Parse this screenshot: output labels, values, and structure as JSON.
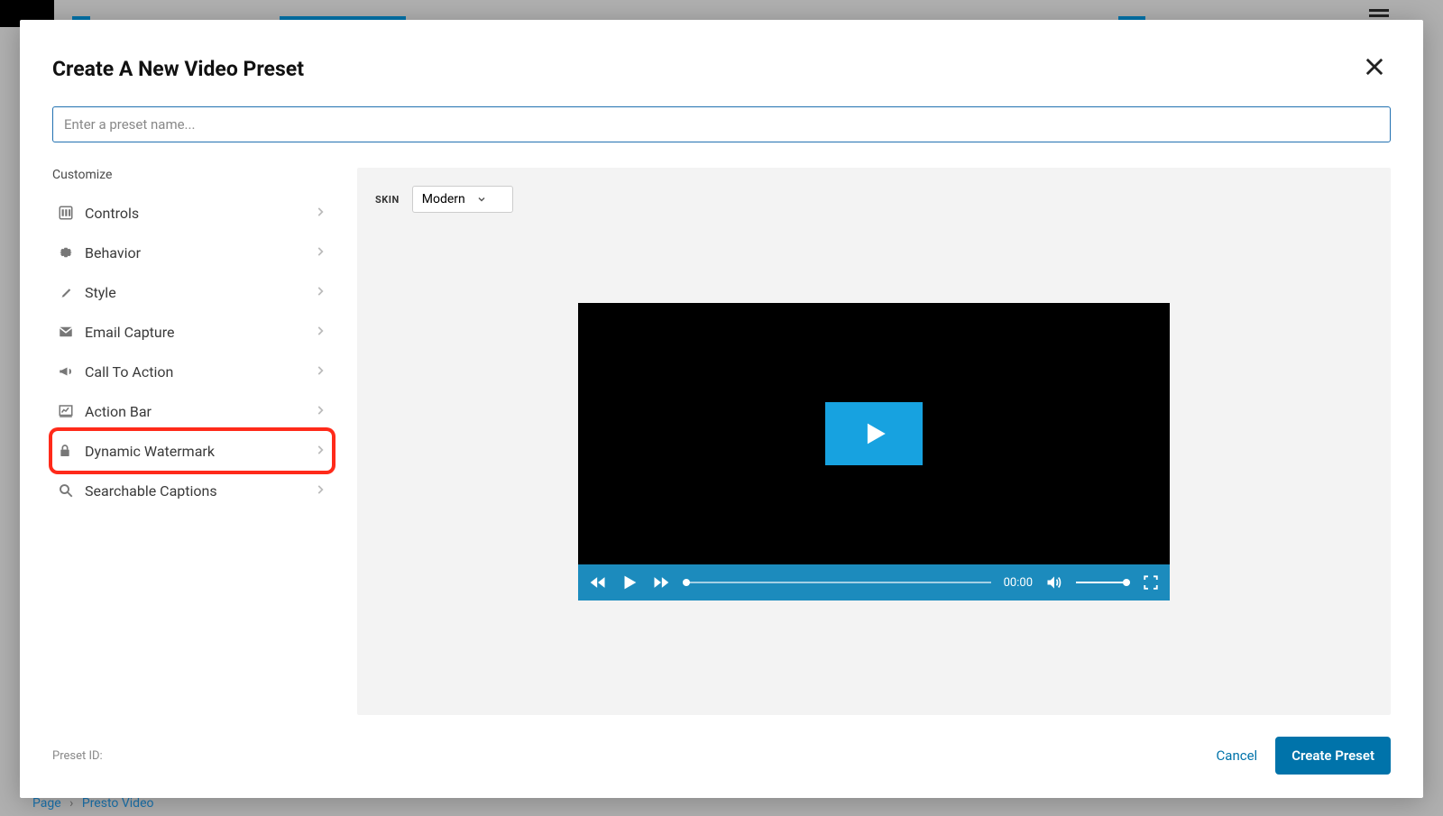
{
  "modal": {
    "title": "Create A New Video Preset",
    "name_placeholder": "Enter a preset name...",
    "customize_label": "Customize",
    "preset_id_label": "Preset ID:",
    "cancel_label": "Cancel",
    "create_label": "Create Preset"
  },
  "sidebar": {
    "items": [
      {
        "label": "Controls",
        "icon": "controls"
      },
      {
        "label": "Behavior",
        "icon": "gear"
      },
      {
        "label": "Style",
        "icon": "brush"
      },
      {
        "label": "Email Capture",
        "icon": "mail"
      },
      {
        "label": "Call To Action",
        "icon": "megaphone"
      },
      {
        "label": "Action Bar",
        "icon": "chart"
      },
      {
        "label": "Dynamic Watermark",
        "icon": "lock"
      },
      {
        "label": "Searchable Captions",
        "icon": "search"
      }
    ],
    "highlight_index": 6
  },
  "preview": {
    "skin_label": "SKIN",
    "skin_value": "Modern",
    "time": "00:00"
  },
  "breadcrumb": {
    "a": "Page",
    "b": "Presto Video"
  },
  "colors": {
    "accent": "#0073aa",
    "highlight": "#ff2a1a",
    "player_blue": "#17a2e0",
    "controlbar": "#1c8bbd"
  }
}
